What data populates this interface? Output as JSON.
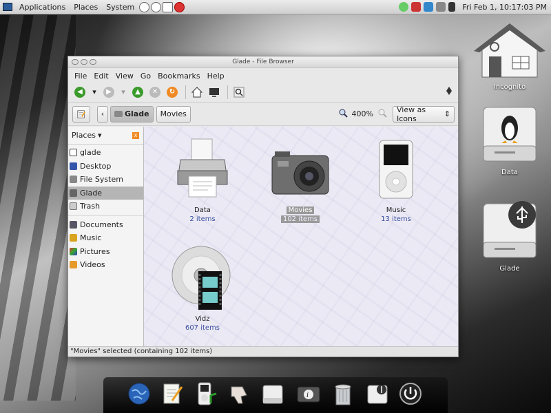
{
  "top_panel": {
    "menus": [
      "Applications",
      "Places",
      "System"
    ],
    "clock": "Fri Feb  1, 10:17:03 PM"
  },
  "window": {
    "title": "Glade - File Browser",
    "menu": [
      "File",
      "Edit",
      "View",
      "Go",
      "Bookmarks",
      "Help"
    ],
    "location": {
      "path_buttons": [
        "Glade",
        "Movies"
      ],
      "zoom": "400%",
      "view_mode": "View as Icons"
    },
    "sidebar": {
      "header": "Places",
      "places": [
        {
          "label": "glade",
          "icon": "home-icon"
        },
        {
          "label": "Desktop",
          "icon": "desktop-icon"
        },
        {
          "label": "File System",
          "icon": "filesystem-icon"
        },
        {
          "label": "Glade",
          "icon": "drive-icon",
          "selected": true
        },
        {
          "label": "Trash",
          "icon": "trash-icon"
        }
      ],
      "bookmarks": [
        {
          "label": "Documents",
          "icon": "folder-icon"
        },
        {
          "label": "Music",
          "icon": "music-icon"
        },
        {
          "label": "Pictures",
          "icon": "pictures-icon"
        },
        {
          "label": "Videos",
          "icon": "videos-icon"
        }
      ]
    },
    "files": [
      {
        "name": "Data",
        "count": "2 items",
        "icon": "printer-icon"
      },
      {
        "name": "Movies",
        "count": "102 items",
        "icon": "camera-icon",
        "selected": true
      },
      {
        "name": "Music",
        "count": "13 items",
        "icon": "ipod-icon"
      },
      {
        "name": "Vidz",
        "count": "607 items",
        "icon": "dvd-video-icon"
      }
    ],
    "status": "\"Movies\" selected (containing 102 items)"
  },
  "desktop": {
    "icons": [
      {
        "label": "Incognito",
        "icon": "home-icon"
      },
      {
        "label": "Data",
        "icon": "linux-drive-icon"
      },
      {
        "label": "Glade",
        "icon": "usb-drive-icon"
      }
    ]
  },
  "dock": {
    "items": [
      "globe-icon",
      "notepad-icon",
      "ipod-music-icon",
      "thumbs-down-icon",
      "drive-icon",
      "camera-info-icon",
      "trash-can-icon",
      "usb-drive-icon",
      "power-icon"
    ]
  }
}
